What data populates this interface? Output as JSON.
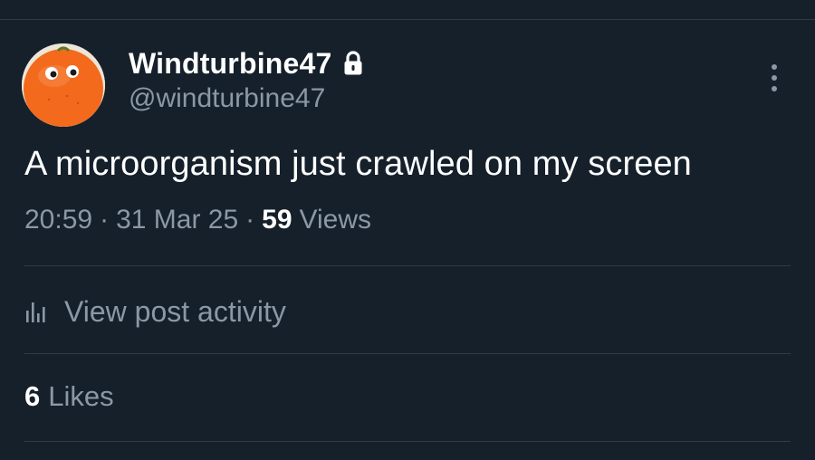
{
  "author": {
    "display_name": "Windturbine47",
    "handle": "@windturbine47",
    "protected": true,
    "lock_icon": "lock-icon",
    "avatar_description_icon": "avatar"
  },
  "post": {
    "text": "A microorganism just crawled on my screen",
    "time": "20:59",
    "date": "31 Mar 25",
    "separator": "·",
    "views_count": "59",
    "views_label": "Views"
  },
  "activity": {
    "icon": "bar-chart-icon",
    "label": "View post activity"
  },
  "likes": {
    "count": "6",
    "label": "Likes"
  },
  "menu": {
    "icon": "more-vertical-icon"
  },
  "colors": {
    "background": "#15202b",
    "primary_text": "#ffffff",
    "secondary_text": "#8b98a5",
    "divider": "#2f3b47",
    "avatar_orange": "#f36a1d"
  }
}
